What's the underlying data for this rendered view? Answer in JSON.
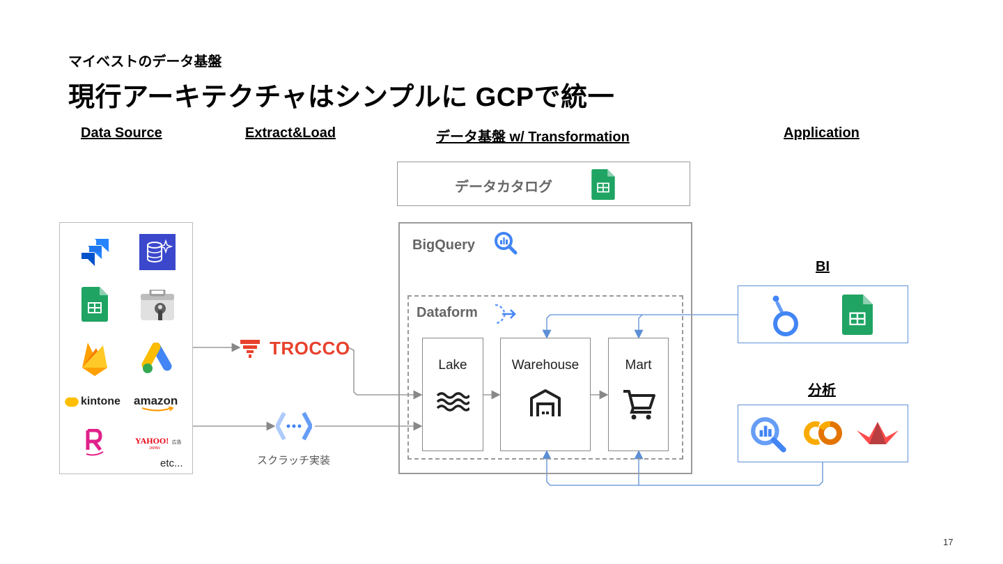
{
  "slide": {
    "kicker": "マイベストのデータ基盤",
    "title": "現行アーキテクチャはシンプルに GCPで統一",
    "page_number": "17"
  },
  "columns": {
    "data_source": "Data Source",
    "extract_load": "Extract&Load",
    "platform": "データ基盤 w/ Transformation",
    "application": "Application"
  },
  "data_sources": {
    "logos": [
      "jira-icon",
      "aws-rds-icon",
      "google-sheets-icon",
      "google-search-console-icon",
      "firebase-icon",
      "google-ads-icon",
      "kintone-logo",
      "amazon-logo",
      "rakuten-icon",
      "yahoo-ads-logo"
    ],
    "kintone_label": "kintone",
    "amazon_label": "amazon",
    "yahoo_label": "YAHOO!",
    "yahoo_sub": "広告",
    "yahoo_japan": "JAPAN",
    "etc_label": "etc..."
  },
  "extract_load": {
    "trocco_label": "TROCCO",
    "scratch_label": "スクラッチ実装"
  },
  "catalog": {
    "label": "データカタログ"
  },
  "platform": {
    "bigquery_label": "BigQuery",
    "dataform_label": "Dataform",
    "layers": [
      {
        "name": "Lake",
        "icon": "waves-icon"
      },
      {
        "name": "Warehouse",
        "icon": "warehouse-icon"
      },
      {
        "name": "Mart",
        "icon": "cart-icon"
      }
    ]
  },
  "application": {
    "bi_label": "BI",
    "bi_tools": [
      "looker-studio-icon",
      "google-sheets-icon"
    ],
    "analysis_label": "分析",
    "analysis_tools": [
      "bigquery-icon",
      "colab-icon",
      "streamlit-icon"
    ]
  },
  "colors": {
    "arrow_gray": "#888888",
    "arrow_blue": "#5b8fd6",
    "trocco_red": "#e8412c",
    "sheets_green": "#1fa463",
    "bq_blue": "#4285f4"
  }
}
